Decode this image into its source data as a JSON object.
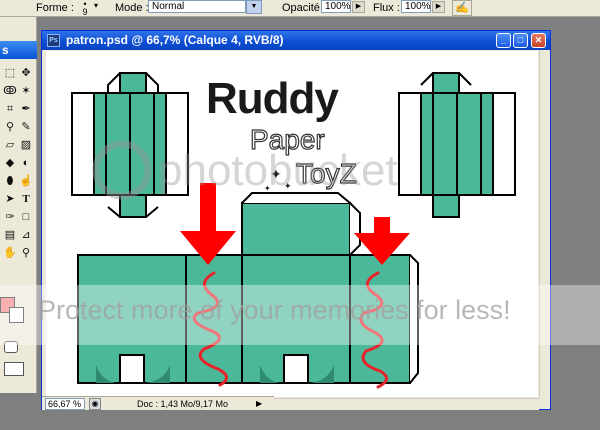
{
  "options_bar": {
    "shape_label": "Forme :",
    "brush_size": "9",
    "mode_label": "Mode :",
    "mode_value": "Normal",
    "opacity_label": "Opacité :",
    "opacity_value": "100%",
    "flow_label": "Flux :",
    "flow_value": "100%"
  },
  "toolbox": {
    "title_fragment": "s",
    "fg_color": "#f47f7f",
    "bg_color": "#ffffff",
    "tools": [
      "move-icon",
      "lasso-icon",
      "magic-wand-icon",
      "crop-icon",
      "healing-icon",
      "brush-icon",
      "stamp-icon",
      "history-brush-icon",
      "eraser-icon",
      "gradient-icon",
      "blur-icon",
      "dodge-icon",
      "path-select-icon",
      "type-icon",
      "pen-icon",
      "shape-icon",
      "notes-icon",
      "eyedropper-icon",
      "hand-icon",
      "zoom-icon"
    ]
  },
  "document": {
    "title": "patron.psd @ 66,7% (Calque 4, RVB/8)",
    "zoom": "66,67 %",
    "doc_size": "Doc : 1,43 Mo/9,17 Mo",
    "logo": {
      "line1": "Ruddy",
      "line2": "Paper",
      "line3": "ToyZ"
    },
    "colors": {
      "teal": "#4bb89a",
      "teal_dark": "#2e8a70",
      "arrow": "#ff0000",
      "squiggle": "#e8242a"
    }
  },
  "watermark": {
    "text": "Protect more of your memories for less!"
  }
}
